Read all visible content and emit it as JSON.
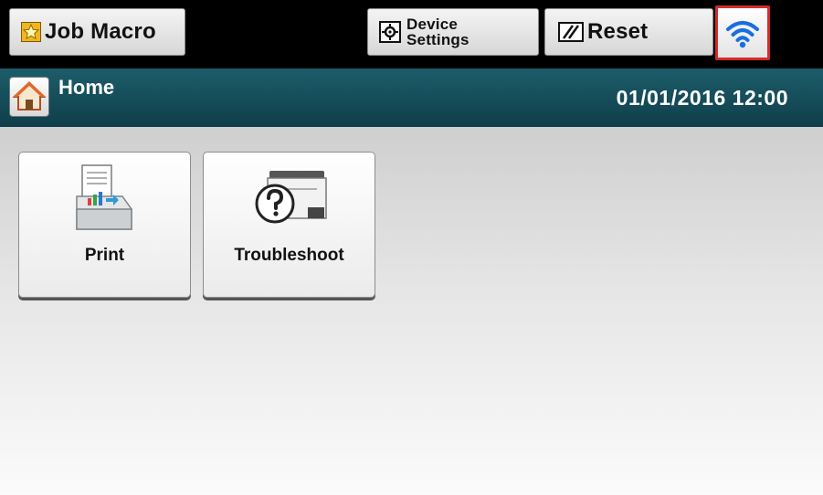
{
  "topbar": {
    "job_macro_label": "Job Macro",
    "device_settings_label": "Device\nSettings",
    "reset_label": "Reset",
    "icons": {
      "job_macro": "star-icon",
      "device_settings": "gear-icon",
      "reset": "reset-icon",
      "wifi": "wifi-icon"
    },
    "wifi_highlight_color": "#d42b2b"
  },
  "titlebar": {
    "title": "Home",
    "datetime": "01/01/2016 12:00",
    "icon": "home-icon"
  },
  "tiles": [
    {
      "label": "Print",
      "icon": "print-icon"
    },
    {
      "label": "Troubleshoot",
      "icon": "troubleshoot-icon"
    }
  ],
  "colors": {
    "titlebar": "#1d5d6a",
    "topbar": "#000000",
    "wifi_blue": "#1a6fe0"
  }
}
